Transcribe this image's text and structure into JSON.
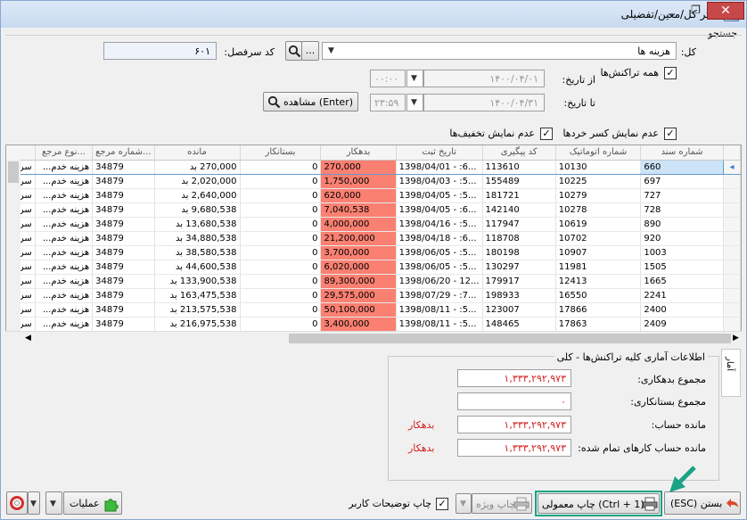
{
  "window": {
    "title": "دفتر کل/معین/تفضیلی"
  },
  "search": {
    "group_label": "جستجو",
    "kol_label": "کل:",
    "kol_value": "هزینه ها",
    "ellipsis": "...",
    "code_label": "کد سرفصل:",
    "code_value": "۶۰۱",
    "all_transactions_label": "همه تراکنش‌ها",
    "from_date_label": "از تاریخ:",
    "from_date_value": "۱۴۰۰/۰۴/۰۱",
    "from_time_value": "۰۰:۰۰",
    "to_date_label": "تا تاریخ:",
    "to_date_value": "۱۴۰۰/۰۴/۳۱",
    "to_time_value": "۲۳:۵۹",
    "view_button": "مشاهده (Enter)",
    "no_fraction_label": "عدم نمایش کسر خردها",
    "no_discount_label": "عدم نمایش تخفیف‌ها"
  },
  "grid": {
    "columns": [
      "شماره سند",
      "شماره اتوماتیک",
      "کد پیگیری",
      "تاریخ ثبت",
      "بدهکار",
      "بستانکار",
      "مانده",
      "شماره مرجع...",
      "نوع مرجع...",
      ""
    ],
    "rows": [
      [
        "660",
        "10130",
        "113610",
        "1398/04/01 - :6...",
        "270,000",
        "0",
        "270,000 بد",
        "34879",
        "هزینه خدم...",
        "سر"
      ],
      [
        "697",
        "10225",
        "155489",
        "1398/04/03 - :5...",
        "1,750,000",
        "0",
        "2,020,000 بد",
        "34879",
        "هزینه خدم...",
        "سر"
      ],
      [
        "727",
        "10279",
        "181721",
        "1398/04/05 - :5...",
        "620,000",
        "0",
        "2,640,000 بد",
        "34879",
        "هزینه خدم...",
        "سر"
      ],
      [
        "728",
        "10278",
        "142140",
        "1398/04/05 - :6...",
        "7,040,538",
        "0",
        "9,680,538 بد",
        "34879",
        "هزینه خدم...",
        "سر"
      ],
      [
        "890",
        "10619",
        "117947",
        "1398/04/16 - :5...",
        "4,000,000",
        "0",
        "13,680,538 بد",
        "34879",
        "هزینه خدم...",
        "سر"
      ],
      [
        "920",
        "10702",
        "118708",
        "1398/04/18 - :6...",
        "21,200,000",
        "0",
        "34,880,538 بد",
        "34879",
        "هزینه خدم...",
        "سر"
      ],
      [
        "1003",
        "10907",
        "180198",
        "1398/06/05 - :5...",
        "3,700,000",
        "0",
        "38,580,538 بد",
        "34879",
        "هزینه خدم...",
        "سر"
      ],
      [
        "1505",
        "11981",
        "130297",
        "1398/06/05 - :5...",
        "6,020,000",
        "0",
        "44,600,538 بد",
        "34879",
        "هزینه خدم...",
        "سر"
      ],
      [
        "1665",
        "12413",
        "179917",
        "1398/06/20 - 12...",
        "89,300,000",
        "0",
        "133,900,538 بد",
        "34879",
        "هزینه خدم...",
        "سر"
      ],
      [
        "2241",
        "16550",
        "198933",
        "1398/07/29 - :7...",
        "29,575,000",
        "0",
        "163,475,538 بد",
        "34879",
        "هزینه خدم...",
        "سر"
      ],
      [
        "2400",
        "17866",
        "123007",
        "1398/08/11 - :5...",
        "50,100,000",
        "0",
        "213,575,538 بد",
        "34879",
        "هزینه خدم...",
        "سر"
      ],
      [
        "2409",
        "17863",
        "148465",
        "1398/08/11 - :5...",
        "3,400,000",
        "0",
        "216,975,538 بد",
        "34879",
        "هزینه خدم...",
        "سر"
      ]
    ]
  },
  "stats": {
    "title": "اطلاعات آماری کلیه تراکنش‌ها - کلی",
    "tab_label": "آمار",
    "debit_label": "مجموع بدهکاری:",
    "debit_value": "۱,۳۳۳,۲۹۲,۹۷۳",
    "credit_label": "مجموع بستانکاری:",
    "credit_value": "۰",
    "balance_label": "مانده حساب:",
    "balance_value": "۱,۳۳۳,۲۹۲,۹۷۳",
    "balance_status": "بدهکار",
    "completed_label": "مانده حساب کارهای تمام شده:",
    "completed_value": "۱,۳۳۳,۲۹۲,۹۷۳",
    "completed_status": "بدهکار"
  },
  "bottom": {
    "close_button": "(ESC) بستن",
    "print_normal_button": "چاپ معمولی (Ctrl + 1)",
    "print_special_button": "چاپ ویژه",
    "user_notes_label": "چاپ توضیحات کاربر",
    "operations_button": "عملیات"
  },
  "colors": {
    "debit_highlight": "#fa8072",
    "stat_value": "#d42020",
    "annotation_arrow": "#1aa384"
  }
}
